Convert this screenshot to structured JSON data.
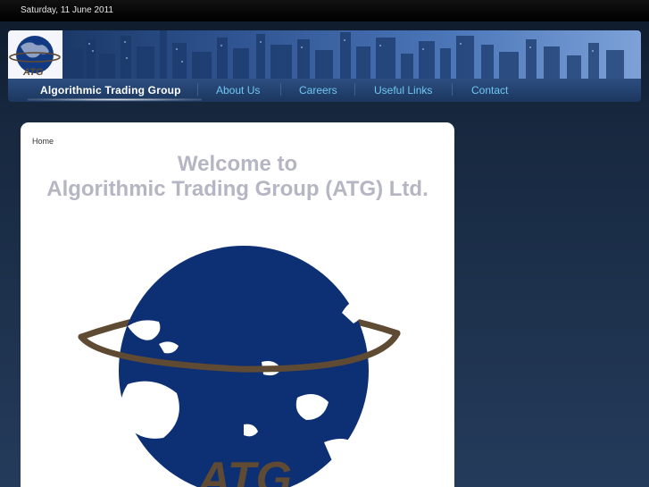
{
  "topbar": {
    "date": "Saturday, 11 June 2011"
  },
  "header": {
    "logo_text": "ATG"
  },
  "nav": {
    "items": [
      {
        "label": "Algorithmic Trading Group",
        "active": true
      },
      {
        "label": "About Us",
        "active": false
      },
      {
        "label": "Careers",
        "active": false
      },
      {
        "label": "Useful Links",
        "active": false
      },
      {
        "label": "Contact",
        "active": false
      }
    ]
  },
  "main": {
    "breadcrumb": "Home",
    "welcome_line1": "Welcome to",
    "welcome_line2": "Algorithmic Trading Group (ATG) Ltd.",
    "logo_text": "ATG"
  },
  "colors": {
    "globe": "#0d2f73",
    "ring": "#5f4a33",
    "nav_link": "#6fc7f2",
    "title": "#b5b5c3"
  }
}
